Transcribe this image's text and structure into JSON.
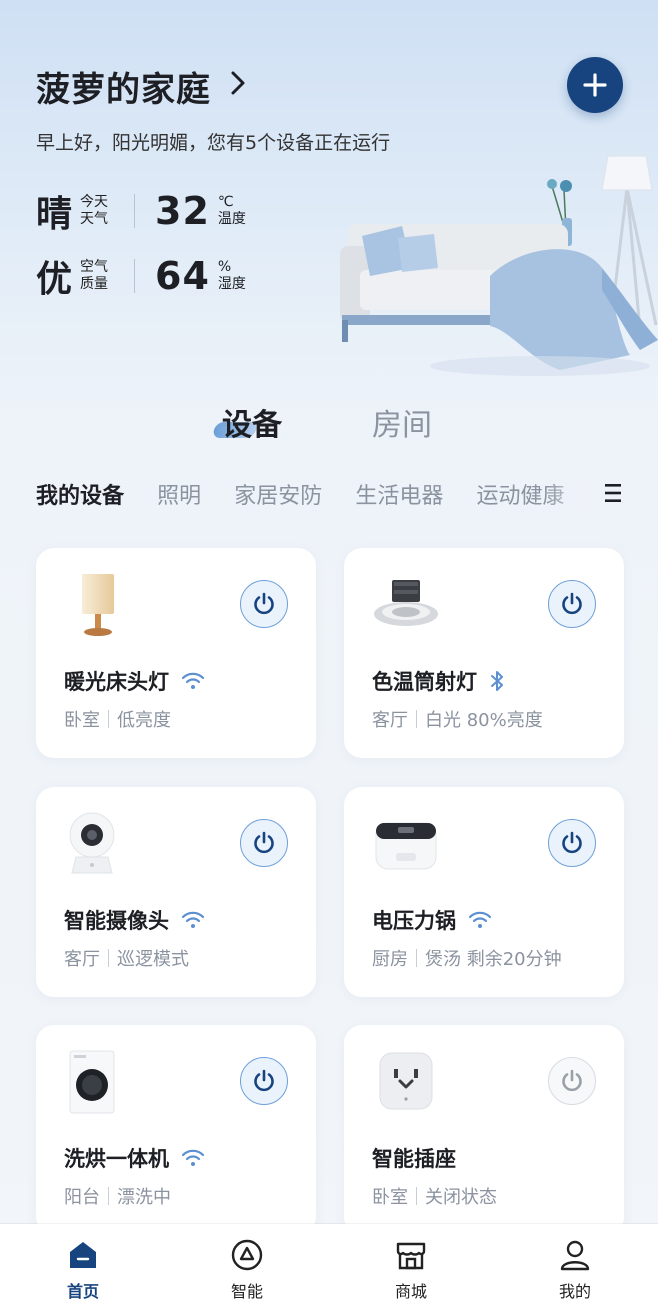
{
  "header": {
    "title": "菠萝的家庭",
    "greeting": "早上好，阳光明媚，您有5个设备正在运行"
  },
  "stats": {
    "weather_value": "晴",
    "weather_label_1": "今天",
    "weather_label_2": "天气",
    "temp_value": "32",
    "temp_unit": "℃",
    "temp_label": "温度",
    "air_value": "优",
    "air_label_1": "空气",
    "air_label_2": "质量",
    "humidity_value": "64",
    "humidity_unit": "%",
    "humidity_label": "湿度"
  },
  "segment_tabs": [
    {
      "label": "设备",
      "active": true
    },
    {
      "label": "房间",
      "active": false
    }
  ],
  "categories": [
    {
      "label": "我的设备",
      "active": true
    },
    {
      "label": "照明",
      "active": false
    },
    {
      "label": "家居安防",
      "active": false
    },
    {
      "label": "生活电器",
      "active": false
    },
    {
      "label": "运动健康",
      "active": false
    }
  ],
  "devices": [
    {
      "name": "暖光床头灯",
      "room": "卧室",
      "status": "低亮度",
      "connection": "wifi-icon",
      "power": "on",
      "icon": "bedside-lamp-icon"
    },
    {
      "name": "色温筒射灯",
      "room": "客厅",
      "status": "白光 80%亮度",
      "connection": "bluetooth-icon",
      "power": "on",
      "icon": "downlight-icon"
    },
    {
      "name": "智能摄像头",
      "room": "客厅",
      "status": "巡逻模式",
      "connection": "wifi-icon",
      "power": "on",
      "icon": "camera-icon"
    },
    {
      "name": "电压力锅",
      "room": "厨房",
      "status": "煲汤 剩余20分钟",
      "connection": "wifi-icon",
      "power": "on",
      "icon": "pressure-cooker-icon"
    },
    {
      "name": "洗烘一体机",
      "room": "阳台",
      "status": "漂洗中",
      "connection": "wifi-icon",
      "power": "on",
      "icon": "washer-icon"
    },
    {
      "name": "智能插座",
      "room": "卧室",
      "status": "关闭状态",
      "connection": "",
      "power": "off",
      "icon": "smart-plug-icon"
    }
  ],
  "bottom_nav": [
    {
      "label": "首页",
      "icon": "home-icon",
      "active": true
    },
    {
      "label": "智能",
      "icon": "smart-icon",
      "active": false
    },
    {
      "label": "商城",
      "icon": "store-icon",
      "active": false
    },
    {
      "label": "我的",
      "icon": "profile-icon",
      "active": false
    }
  ],
  "colors": {
    "accent": "#17447f",
    "power_ring": "#6fa0d8",
    "wifi": "#5b8fd0"
  }
}
